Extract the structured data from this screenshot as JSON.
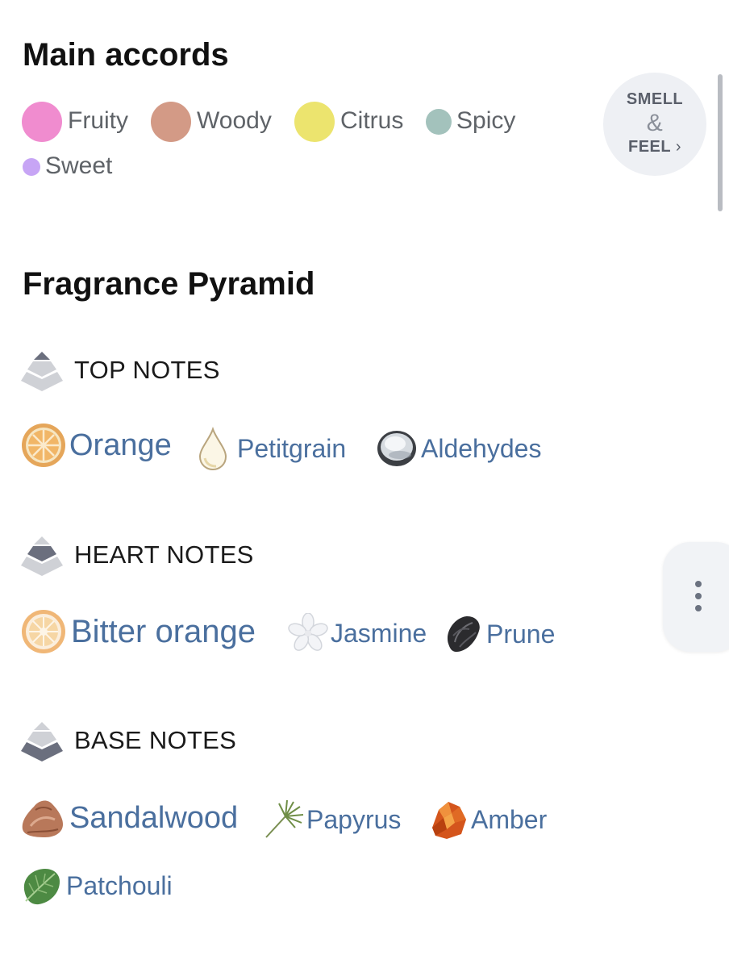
{
  "main_accords": {
    "title": "Main accords",
    "items": [
      {
        "label": "Fruity",
        "color": "#f08ccf"
      },
      {
        "label": "Woody",
        "color": "#d39a86"
      },
      {
        "label": "Citrus",
        "color": "#ece46e"
      },
      {
        "label": "Spicy",
        "color": "#a3c2bc"
      },
      {
        "label": "Sweet",
        "color": "#c7a5f5"
      }
    ]
  },
  "smell_feel": {
    "line1": "SMELL",
    "amp": "&",
    "line2": "FEEL",
    "chevron": "›"
  },
  "pyramid": {
    "title": "Fragrance Pyramid",
    "levels": [
      {
        "label": "TOP NOTES",
        "icon": "pyramid-top-icon",
        "notes": [
          {
            "name": "Orange",
            "icon": "orange-slice-icon"
          },
          {
            "name": "Petitgrain",
            "icon": "droplet-icon"
          },
          {
            "name": "Aldehydes",
            "icon": "aldehydes-droplet-icon"
          }
        ]
      },
      {
        "label": "HEART NOTES",
        "icon": "pyramid-heart-icon",
        "notes": [
          {
            "name": "Bitter orange",
            "icon": "bitter-orange-icon"
          },
          {
            "name": "Jasmine",
            "icon": "jasmine-flower-icon"
          },
          {
            "name": "Prune",
            "icon": "prune-icon"
          }
        ]
      },
      {
        "label": "BASE NOTES",
        "icon": "pyramid-base-icon",
        "notes": [
          {
            "name": "Sandalwood",
            "icon": "sandalwood-icon"
          },
          {
            "name": "Papyrus",
            "icon": "papyrus-icon"
          },
          {
            "name": "Amber",
            "icon": "amber-icon"
          },
          {
            "name": "Patchouli",
            "icon": "patchouli-leaf-icon"
          }
        ]
      }
    ]
  },
  "side_menu_icon": "more-vertical-icon"
}
